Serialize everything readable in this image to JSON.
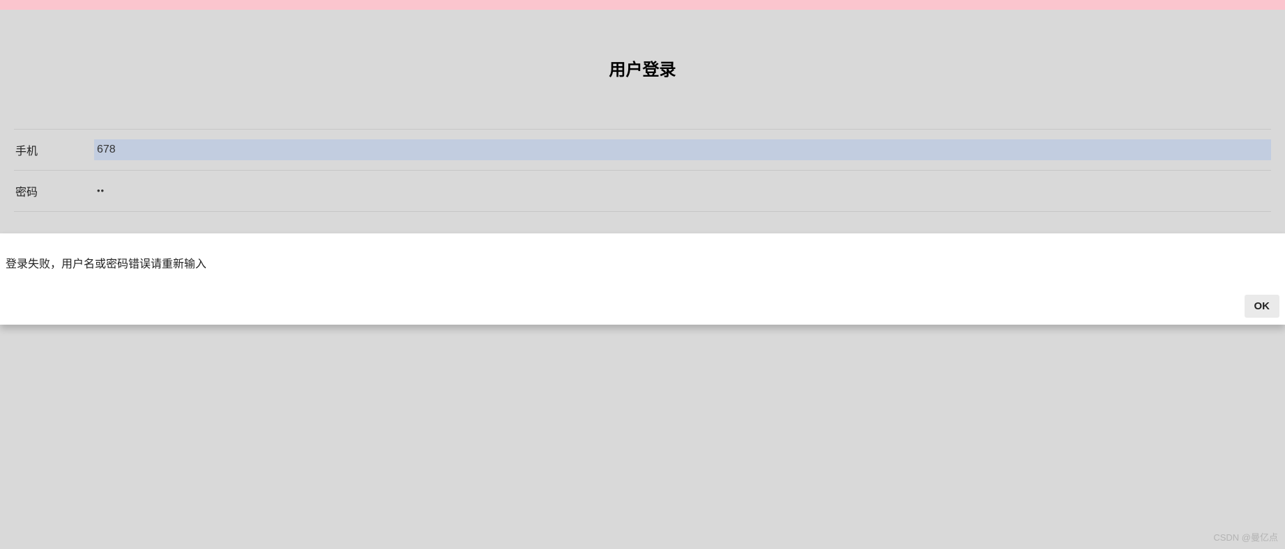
{
  "header": {
    "title": "用户登录"
  },
  "form": {
    "phone": {
      "label": "手机",
      "value": "678"
    },
    "password": {
      "label": "密码",
      "value": "••"
    }
  },
  "alert": {
    "message": "登录失败，用户名或密码错误请重新输入",
    "ok_label": "OK"
  },
  "watermark": "CSDN @曼亿点"
}
